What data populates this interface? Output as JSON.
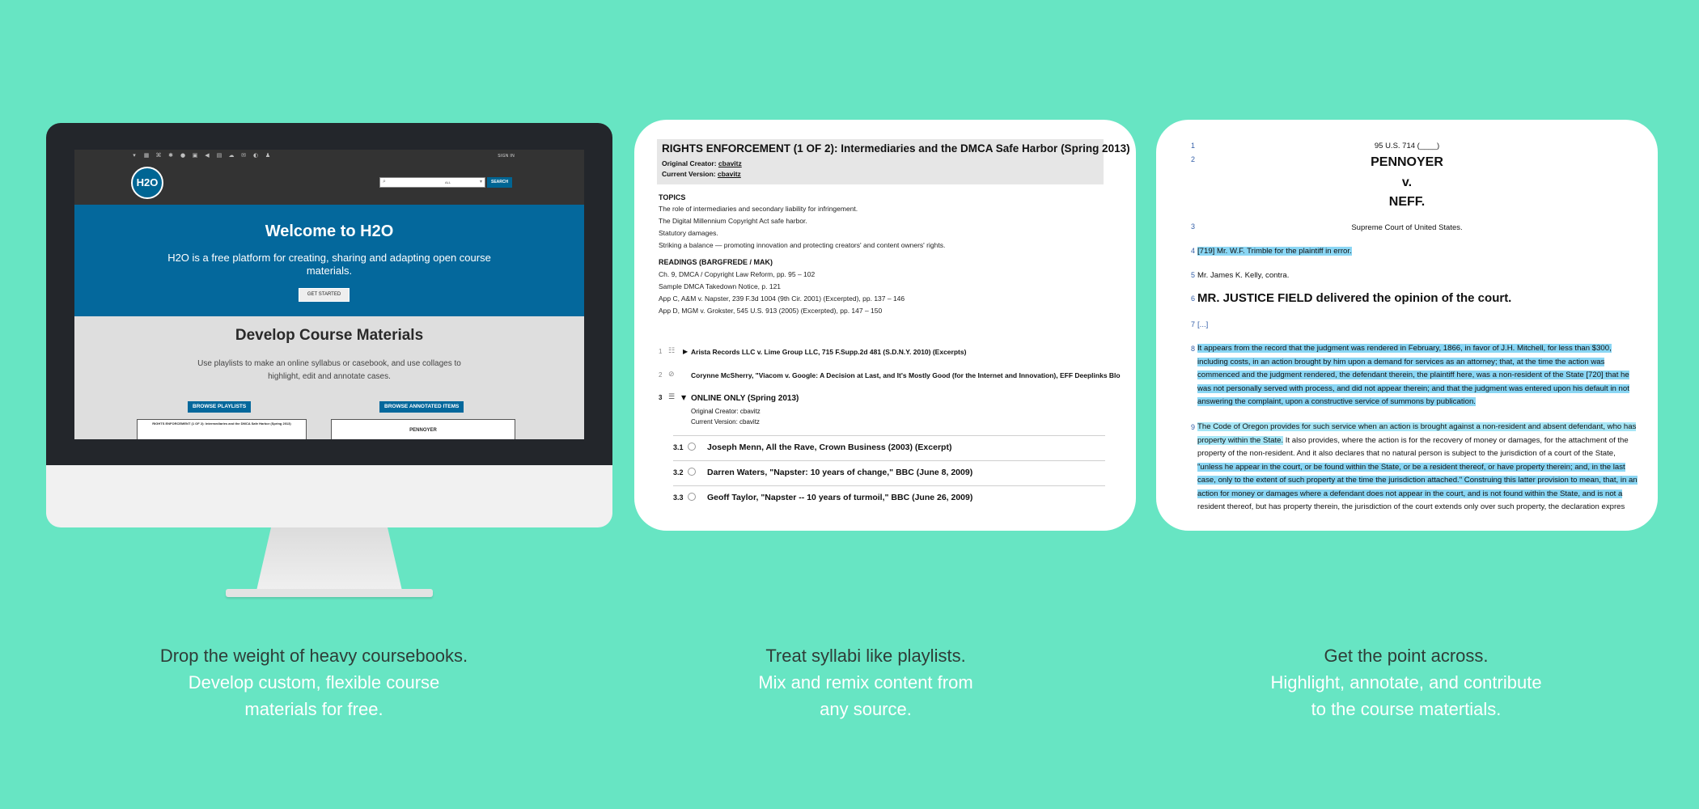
{
  "background_color": "#67e5c3",
  "accent_color": "#04689c",
  "monitor": {
    "toolbar_icons": [
      "filter-icon",
      "grid-icon",
      "network-icon",
      "settings-icon",
      "record-icon",
      "image-icon",
      "speaker-icon",
      "doc-icon",
      "cloud-icon",
      "mail-icon",
      "share-icon",
      "user-icon"
    ],
    "signin": "SIGN IN",
    "logo": "H2O",
    "search": {
      "value": "ALL",
      "button": "SEARCH"
    },
    "hero": {
      "title": "Welcome to H2O",
      "subtitle": "H2O is a free platform for creating, sharing and adapting open course materials.",
      "button": "GET STARTED"
    },
    "develop": {
      "title": "Develop Course Materials",
      "subtitle": "Use playlists to make an online syllabus or casebook, and use collages to highlight, edit and annotate cases.",
      "browse_playlists": "BROWSE PLAYLISTS",
      "browse_annotated": "BROWSE ANNOTATED ITEMS",
      "mini_left_title": "RIGHTS ENFORCEMENT (1 OF 2): Intermediaries and the DMCA Safe Harbor (Spring 2013)",
      "mini_right_title": "PENNOYER"
    }
  },
  "playlist": {
    "title": "RIGHTS ENFORCEMENT (1 OF 2): Intermediaries and the DMCA Safe Harbor (Spring 2013)",
    "original_creator_label": "Original Creator:",
    "original_creator": "cbavitz",
    "current_version_label": "Current Version:",
    "current_version": "cbavitz",
    "topics_heading": "TOPICS",
    "topics": [
      "The role of intermediaries and secondary liability for infringement.",
      "The Digital Millennium Copyright Act safe harbor.",
      "Statutory damages.",
      "Striking a balance — promoting innovation and protecting creators' and content owners' rights."
    ],
    "readings_heading": "READINGS (BARGFREDE / MAK)",
    "readings": [
      "Ch. 9, DMCA / Copyright Law Reform, pp. 95 – 102",
      "Sample DMCA Takedown Notice, p. 121",
      "App C, A&M v. Napster, 239 F.3d 1004 (9th Cir. 2001) (Excerpted), pp. 137 – 146",
      "App D, MGM v. Grokster, 545 U.S. 913 (2005) (Excerpted), pp. 147 – 150"
    ],
    "items": [
      {
        "num": "1",
        "text": "Arista Records LLC v. Lime Group LLC, 715 F.Supp.2d 481 (S.D.N.Y. 2010) (Excerpts)"
      },
      {
        "num": "2",
        "text": "Corynne McSherry, \"Viacom v. Google: A Decision at Last, and It's Mostly Good (for the Internet and Innovation), EFF Deeplinks Blo"
      },
      {
        "num": "3",
        "text": "ONLINE ONLY (Spring 2013)",
        "meta1": "Original Creator: cbavitz",
        "meta2": "Current Version: cbavitz"
      }
    ],
    "subitems": [
      {
        "num": "3.1",
        "text": "Joseph Menn, All the Rave, Crown Business (2003) (Excerpt)"
      },
      {
        "num": "3.2",
        "text": "Darren Waters, \"Napster: 10 years of change,\" BBC (June 8, 2009)"
      },
      {
        "num": "3.3",
        "text": "Geoff Taylor, \"Napster -- 10 years of turmoil,\" BBC (June 26, 2009)"
      }
    ]
  },
  "case": {
    "citation": "95 U.S. 714 (____)",
    "party1": "PENNOYER",
    "v": "v.",
    "party2": "NEFF.",
    "court": "Supreme Court of United States.",
    "counsel1": "[719] Mr. W.F. Trimble for the plaintiff in error.",
    "counsel2": "Mr. James K. Kelly, contra.",
    "opinion_heading": "MR. JUSTICE FIELD delivered the opinion of the court.",
    "ellipsis": "[...]",
    "para8": "It appears from the record that the judgment was rendered in February, 1866, in favor of J.H. Mitchell, for less than $300, including costs, in an action brought by him upon a demand for services as an attorney; that, at the time the action was commenced and the judgment rendered, the defendant therein, the plaintiff here, was a non-resident of the State [720] that he was not personally served with process, and did not appear therein; and that the judgment was entered upon his default in not answering the complaint, upon a constructive service of summons by publication.",
    "para9_a": "The Code of Oregon provides for such service when an action is brought against a non-resident and absent defendant, who has property within the State.",
    "para9_b": " It also provides, where the action is for the recovery of money or damages, for the attachment of the property of the non-resident. And it also declares that no natural person is subject to the jurisdiction of a court of the State, ",
    "para9_c": "\"unless he appear in the court, or be found within the State, or be a resident thereof, or have property therein; and, in the last case, only to the extent of such property at the time the jurisdiction attached.\" Construing this latter provision to mean, that, in an action for money or damages where a defendant does not appear in the court, and is not found within the State, and is not a",
    "para9_d": " resident thereof, but has property therein, the jurisdiction of the court extends only over such property, the declaration expres",
    "line_numbers": [
      "1",
      "2",
      "3",
      "4",
      "5",
      "6",
      "7",
      "8",
      "9"
    ]
  },
  "captions": [
    {
      "head": "Drop the weight of heavy coursebooks.",
      "line1": "Develop custom, flexible course",
      "line2": "materials for free."
    },
    {
      "head": "Treat syllabi like playlists.",
      "line1": "Mix and remix content from",
      "line2": "any source."
    },
    {
      "head": "Get the point across.",
      "line1": "Highlight, annotate, and contribute",
      "line2": "to the course matertials."
    }
  ]
}
